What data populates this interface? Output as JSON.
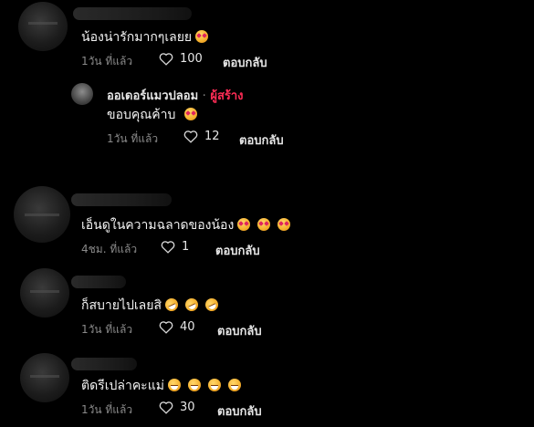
{
  "comments": [
    {
      "text": "น้องน่ารักมากๆเลยย",
      "emojis": [
        "smiling-face-with-heart-eyes"
      ],
      "time": "1วัน ที่แล้ว",
      "likes": "100",
      "reply_label": "ตอบกลับ",
      "reply": {
        "author": "ออเดอร์แมวปลอม",
        "separator": "·",
        "badge": "ผู้สร้าง",
        "text": "ขอบคุณค้าบ",
        "emojis": [
          "smiling-face-with-heart-eyes"
        ],
        "time": "1วัน ที่แล้ว",
        "likes": "12",
        "reply_label": "ตอบกลับ"
      }
    },
    {
      "text": "เอ็นดูในความฉลาดของน้อง",
      "emojis": [
        "smiling-face-with-heart-eyes",
        "smiling-face-with-heart-eyes",
        "smiling-face-with-heart-eyes"
      ],
      "time": "4ชม. ที่แล้ว",
      "likes": "1",
      "reply_label": "ตอบกลับ"
    },
    {
      "text": "ก็สบายไปเลยสิ",
      "emojis": [
        "rolling-on-floor-laughing",
        "rolling-on-floor-laughing",
        "rolling-on-floor-laughing"
      ],
      "time": "1วัน ที่แล้ว",
      "likes": "40",
      "reply_label": "ตอบกลับ"
    },
    {
      "text": "ติดรีเปล่าคะแม่",
      "emojis": [
        "grinning-face",
        "grinning-face",
        "grinning-face",
        "grinning-face"
      ],
      "time": "1วัน ที่แล้ว",
      "likes": "30",
      "reply_label": "ตอบกลับ"
    }
  ],
  "colors": {
    "background": "#000000",
    "creator_badge": "#fe2c55",
    "meta": "#8a8a8a"
  }
}
